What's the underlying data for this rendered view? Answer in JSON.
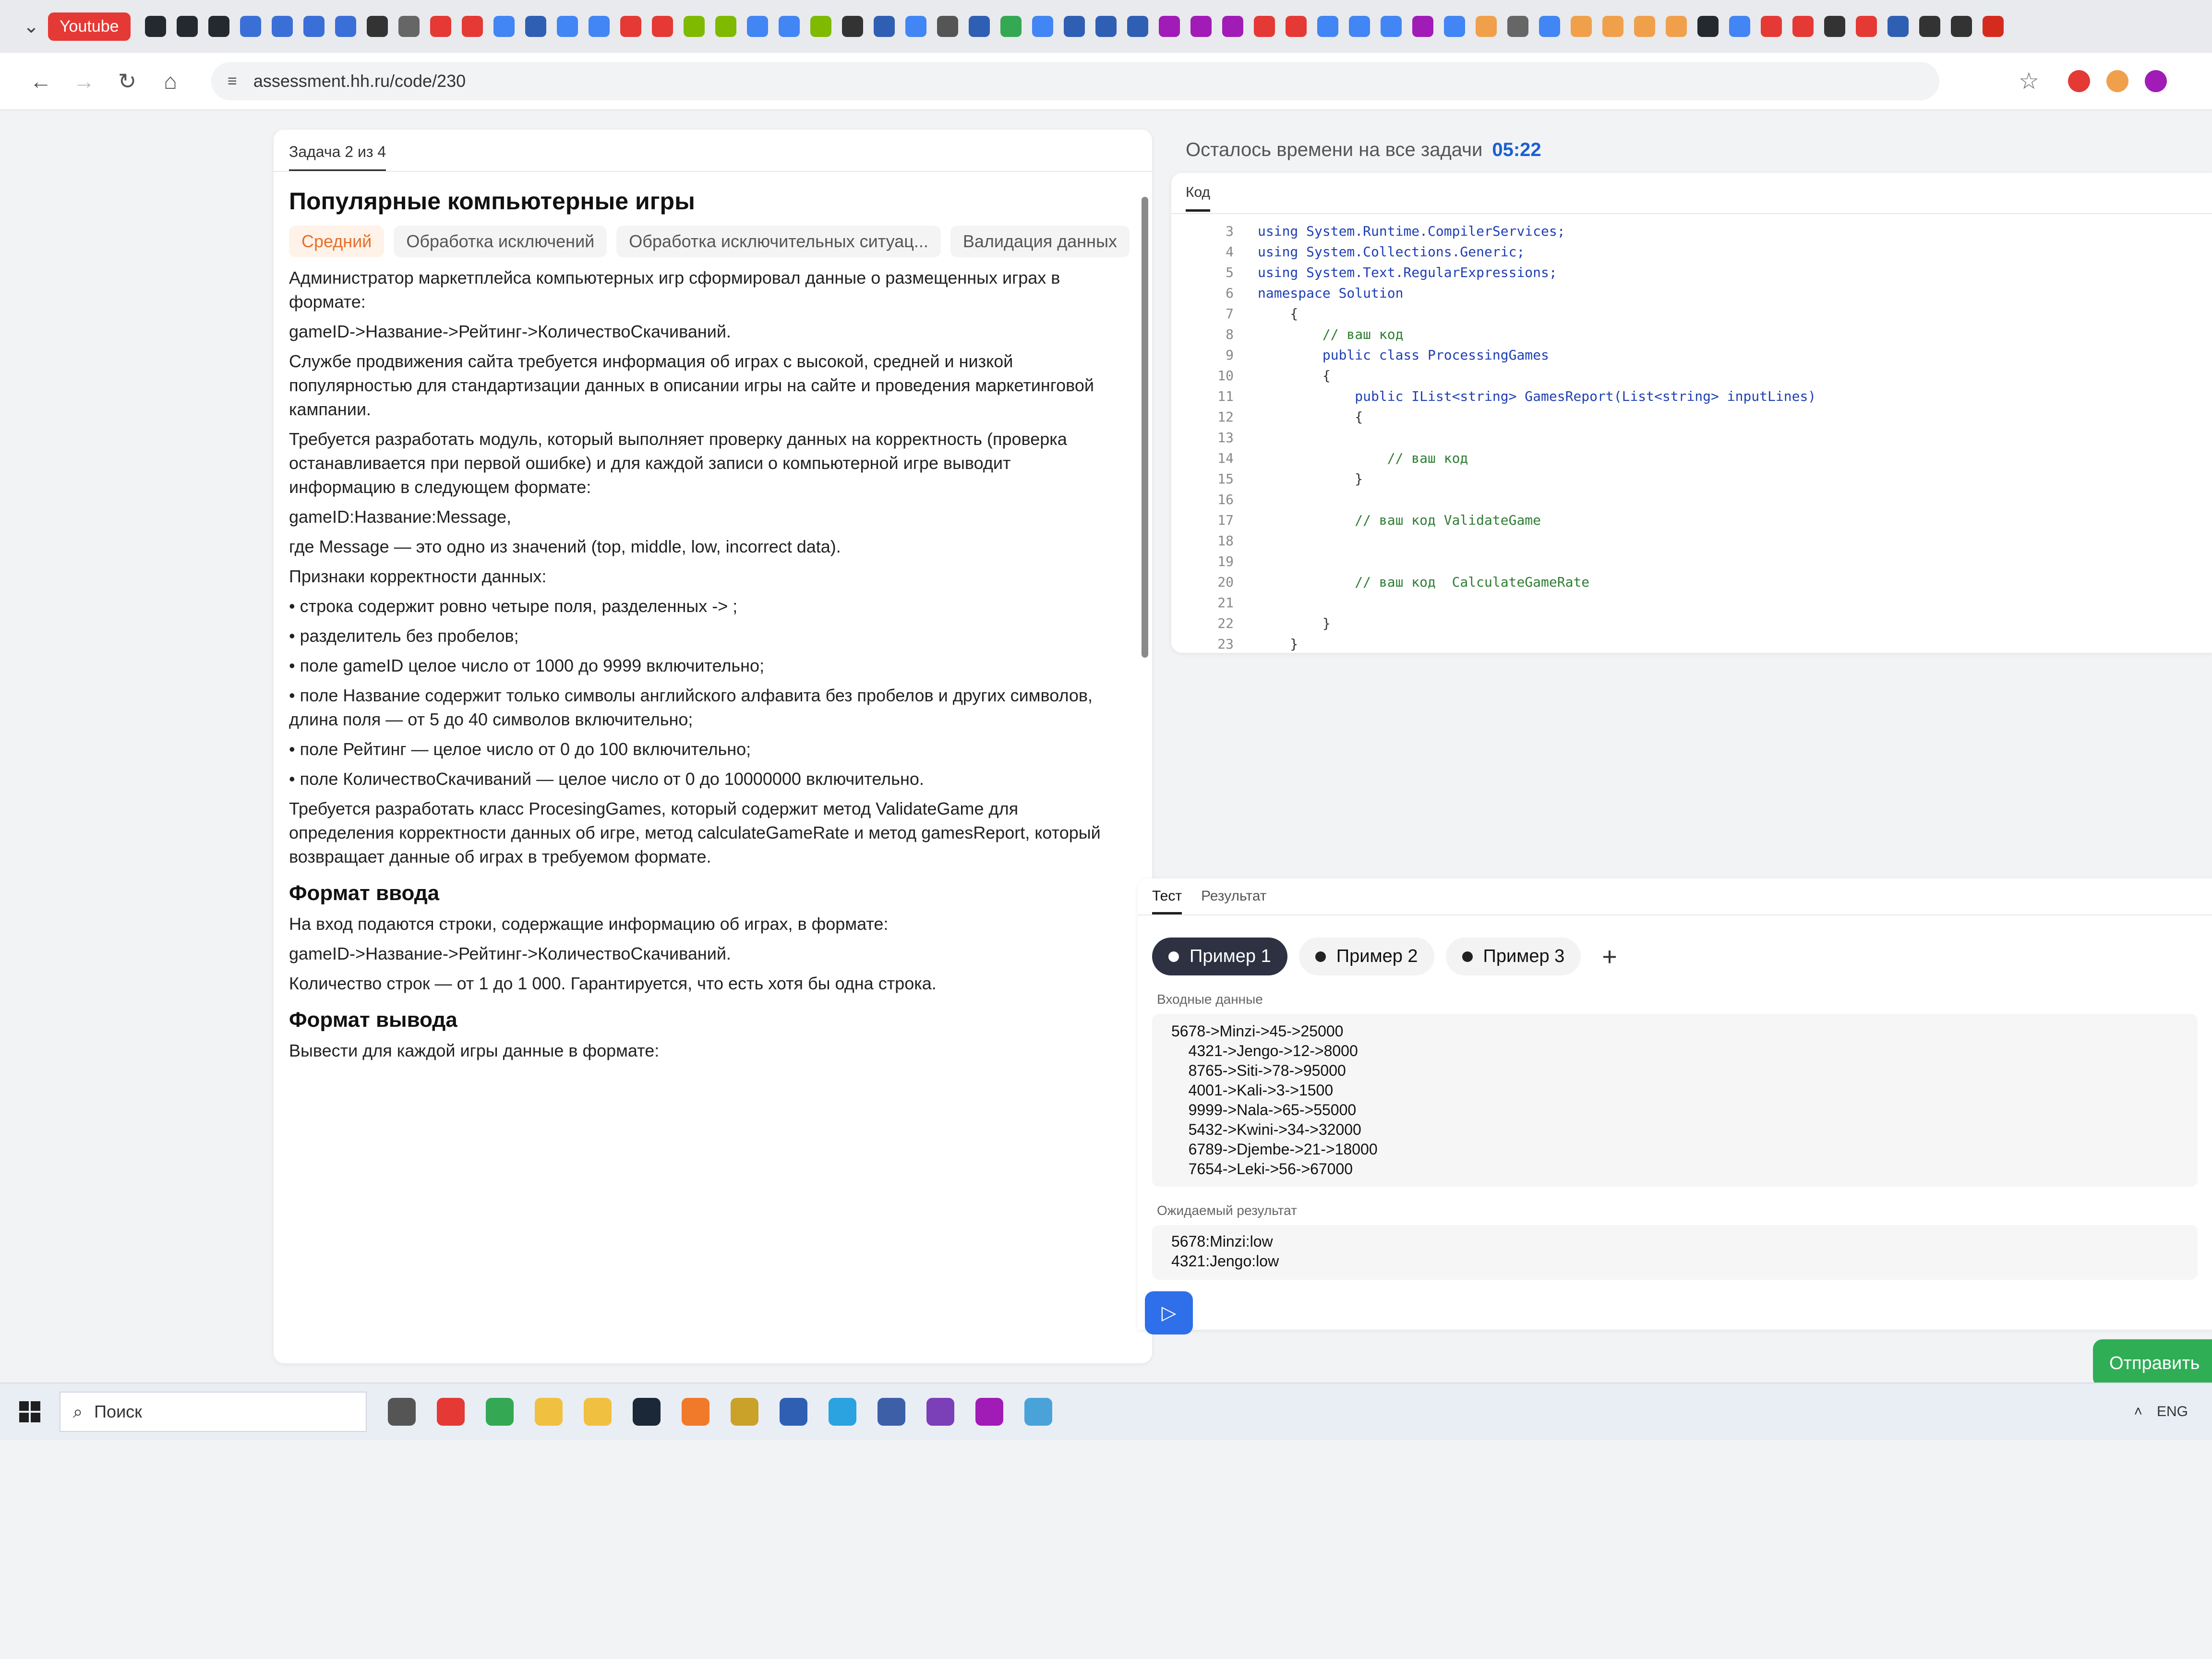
{
  "bookmarks_bar": {
    "menu_glyph": "⌄",
    "youtube_label": "Youtube",
    "icons": [
      {
        "name": "github-icon",
        "color": "#24292f"
      },
      {
        "name": "github-icon",
        "color": "#24292f"
      },
      {
        "name": "github-icon",
        "color": "#24292f"
      },
      {
        "name": "diagram-icon",
        "color": "#3b6fd8"
      },
      {
        "name": "diagram-icon",
        "color": "#3b6fd8"
      },
      {
        "name": "diagram-icon",
        "color": "#3b6fd8"
      },
      {
        "name": "diagram-icon",
        "color": "#3b6fd8"
      },
      {
        "name": "u-icon",
        "color": "#333333"
      },
      {
        "name": "globe-icon",
        "color": "#666666"
      },
      {
        "name": "youtube-icon",
        "color": "#e53935"
      },
      {
        "name": "youtube-icon",
        "color": "#e53935"
      },
      {
        "name": "google-icon",
        "color": "#4285f4"
      },
      {
        "name": "doc-icon",
        "color": "#2f5fb3"
      },
      {
        "name": "google-icon",
        "color": "#4285f4"
      },
      {
        "name": "google-icon",
        "color": "#4285f4"
      },
      {
        "name": "youtube-icon",
        "color": "#e53935"
      },
      {
        "name": "youtube-icon",
        "color": "#e53935"
      },
      {
        "name": "microsoft-icon",
        "color": "#7fba00"
      },
      {
        "name": "microsoft-icon",
        "color": "#7fba00"
      },
      {
        "name": "google-icon",
        "color": "#4285f4"
      },
      {
        "name": "google-icon",
        "color": "#4285f4"
      },
      {
        "name": "microsoft-icon",
        "color": "#7fba00"
      },
      {
        "name": "app-icon",
        "color": "#333333"
      },
      {
        "name": "doc-icon",
        "color": "#2f5fb3"
      },
      {
        "name": "google-icon",
        "color": "#4285f4"
      },
      {
        "name": "wikipedia-icon",
        "color": "#555555"
      },
      {
        "name": "app-icon",
        "color": "#2f5fb3"
      },
      {
        "name": "play-icon",
        "color": "#34a853"
      },
      {
        "name": "google-icon",
        "color": "#4285f4"
      },
      {
        "name": "doc-icon",
        "color": "#2f5fb3"
      },
      {
        "name": "doc-icon",
        "color": "#2f5fb3"
      },
      {
        "name": "doc-icon",
        "color": "#2f5fb3"
      },
      {
        "name": "wildberries-icon",
        "color": "#a11bb7"
      },
      {
        "name": "wildberries-icon",
        "color": "#a11bb7"
      },
      {
        "name": "wildberries-icon",
        "color": "#a11bb7"
      },
      {
        "name": "app-icon",
        "color": "#e53935"
      },
      {
        "name": "app-icon",
        "color": "#e53935"
      },
      {
        "name": "google-icon",
        "color": "#4285f4"
      },
      {
        "name": "google-icon",
        "color": "#4285f4"
      },
      {
        "name": "google-icon",
        "color": "#4285f4"
      },
      {
        "name": "app-icon",
        "color": "#a11bb7"
      },
      {
        "name": "google-icon",
        "color": "#4285f4"
      },
      {
        "name": "app-icon",
        "color": "#f0a04b"
      },
      {
        "name": "globe-icon",
        "color": "#666666"
      },
      {
        "name": "google-icon",
        "color": "#4285f4"
      },
      {
        "name": "app-icon",
        "color": "#f0a04b"
      },
      {
        "name": "app-icon",
        "color": "#f0a04b"
      },
      {
        "name": "app-icon",
        "color": "#f0a04b"
      },
      {
        "name": "app-icon",
        "color": "#f0a04b"
      },
      {
        "name": "github-icon",
        "color": "#24292f"
      },
      {
        "name": "google-icon",
        "color": "#4285f4"
      },
      {
        "name": "app-icon",
        "color": "#e53935"
      },
      {
        "name": "app-icon",
        "color": "#e53935"
      },
      {
        "name": "app-icon",
        "color": "#333333"
      },
      {
        "name": "app-icon",
        "color": "#e53935"
      },
      {
        "name": "app-icon",
        "color": "#2f5fb3"
      },
      {
        "name": "app-icon",
        "color": "#333333"
      },
      {
        "name": "app-icon",
        "color": "#333333"
      },
      {
        "name": "flag-icon",
        "color": "#d52b1e"
      }
    ]
  },
  "navbar": {
    "back_glyph": "←",
    "forward_glyph": "→",
    "reload_glyph": "↻",
    "home_glyph": "⌂",
    "site_info_glyph": "≡",
    "url": "assessment.hh.ru/code/230",
    "star_glyph": "☆",
    "extensions": [
      {
        "name": "adblock-icon",
        "color": "#e53935"
      },
      {
        "name": "extension-icon",
        "color": "#f0a04b"
      },
      {
        "name": "extension-icon",
        "color": "#a11bb7"
      }
    ]
  },
  "task": {
    "counter_tab": "Задача 2 из 4",
    "title": "Популярные компьютерные игры",
    "tags": [
      "Средний",
      "Обработка исключений",
      "Обработка исключительных ситуац...",
      "Валидация данных"
    ],
    "p1": "Администратор маркетплейса компьютерных игр сформировал данные о размещенных играх в формате:",
    "p2": "gameID->Название->Рейтинг->КоличествоСкачиваний.",
    "p3": "Службе продвижения сайта требуется информация об играх с высокой, средней и низкой популярностью для стандартизации данных в описании игры на сайте и проведения маркетинговой кампании.",
    "p4": "Требуется разработать модуль, который выполняет проверку данных на корректность (проверка останавливается при первой ошибке) и для каждой записи о компьютерной игре выводит информацию в следующем формате:",
    "p5": "gameID:Название:Message,",
    "p6": "где Message — это одно из значений (top, middle, low, incorrect data).",
    "p7": "Признаки корректности данных:",
    "rules": [
      "строка содержит ровно четыре поля, разделенных -> ;",
      "разделитель без пробелов;",
      "поле gameID целое число от 1000 до 9999 включительно;",
      "поле Название содержит только символы английского алфавита без пробелов и других символов, длина поля — от 5 до 40 символов включительно;",
      "поле Рейтинг — целое число от 0 до 100 включительно;",
      "поле КоличествоСкачиваний — целое число от 0 до 10000000 включительно."
    ],
    "p8": "Требуется разработать класс ProcesingGames, который содержит метод ValidateGame для определения корректности данных об игре, метод calculateGameRate и метод gamesReport, который возвращает данные об играх в требуемом формате.",
    "h_input": "Формат ввода",
    "in1": "На вход подаются строки, содержащие информацию об играх, в формате:",
    "in2": "gameID->Название->Рейтинг->КоличествоСкачиваний.",
    "in3": "Количество строк — от 1 до 1 000. Гарантируется, что есть хотя бы одна строка.",
    "h_output": "Формат вывода",
    "out1": "Вывести для каждой игры данные в формате:"
  },
  "timer": {
    "label": "Осталось времени на все задачи",
    "value": "05:22"
  },
  "editor": {
    "tab": "Код",
    "lines": [
      {
        "n": "3",
        "t": "using System.Runtime.CompilerServices;",
        "k": "kw"
      },
      {
        "n": "4",
        "t": "using System.Collections.Generic;",
        "k": "kw"
      },
      {
        "n": "5",
        "t": "using System.Text.RegularExpressions;",
        "k": "kw"
      },
      {
        "n": "6",
        "t": "namespace Solution",
        "k": "kw"
      },
      {
        "n": "7",
        "t": "    {",
        "k": ""
      },
      {
        "n": "8",
        "t": "        // ваш код",
        "k": "cm"
      },
      {
        "n": "9",
        "t": "        public class ProcessingGames",
        "k": "kw"
      },
      {
        "n": "10",
        "t": "        {",
        "k": ""
      },
      {
        "n": "11",
        "t": "            public IList<string> GamesReport(List<string> inputLines)",
        "k": "kw"
      },
      {
        "n": "12",
        "t": "            {",
        "k": ""
      },
      {
        "n": "13",
        "t": "",
        "k": ""
      },
      {
        "n": "14",
        "t": "                // ваш код",
        "k": "cm"
      },
      {
        "n": "15",
        "t": "            }",
        "k": ""
      },
      {
        "n": "16",
        "t": "",
        "k": ""
      },
      {
        "n": "17",
        "t": "            // ваш код ValidateGame",
        "k": "cm"
      },
      {
        "n": "18",
        "t": "",
        "k": ""
      },
      {
        "n": "19",
        "t": "",
        "k": ""
      },
      {
        "n": "20",
        "t": "            // ваш код  CalculateGameRate",
        "k": "cm"
      },
      {
        "n": "21",
        "t": "",
        "k": ""
      },
      {
        "n": "22",
        "t": "        }",
        "k": ""
      },
      {
        "n": "23",
        "t": "    }",
        "k": ""
      }
    ]
  },
  "test_panel": {
    "tabs": [
      "Тест",
      "Результат"
    ],
    "examples": [
      "Пример 1",
      "Пример 2",
      "Пример 3"
    ],
    "add_glyph": "+",
    "input_label": "Входные данные",
    "input_lines": [
      "5678->Minzi->45->25000",
      "    4321->Jengo->12->8000",
      "    8765->Siti->78->95000",
      "    4001->Kali->3->1500",
      "    9999->Nala->65->55000",
      "    5432->Kwini->34->32000",
      "    6789->Djembe->21->18000",
      "    7654->Leki->56->67000"
    ],
    "expected_label": "Ожидаемый результат",
    "expected_lines": [
      "5678:Minzi:low",
      "4321:Jengo:low"
    ],
    "run_glyph": "▷",
    "submit_label": "Отправить"
  },
  "taskbar": {
    "search_glyph": "⌕",
    "search_placeholder": "Поиск",
    "apps": [
      {
        "name": "task-view-icon",
        "color": "#555555"
      },
      {
        "name": "opera-icon",
        "color": "#e53935"
      },
      {
        "name": "chrome-icon",
        "color": "#34a853"
      },
      {
        "name": "file-explorer-icon",
        "color": "#f0c040"
      },
      {
        "name": "app-icon",
        "color": "#f0c040"
      },
      {
        "name": "steam-icon",
        "color": "#1b2838"
      },
      {
        "name": "app-icon",
        "color": "#f07a2a"
      },
      {
        "name": "app-icon",
        "color": "#caa22a"
      },
      {
        "name": "app-icon",
        "color": "#2f5fb3"
      },
      {
        "name": "telegram-icon",
        "color": "#2aa3e0"
      },
      {
        "name": "app-icon",
        "color": "#3c5fa8"
      },
      {
        "name": "visual-studio-icon",
        "color": "#7b3fb8"
      },
      {
        "name": "app-icon",
        "color": "#a11bb7"
      },
      {
        "name": "app-icon",
        "color": "#4aa3d8"
      }
    ],
    "tray_up_glyph": "˄",
    "language": "ENG"
  }
}
